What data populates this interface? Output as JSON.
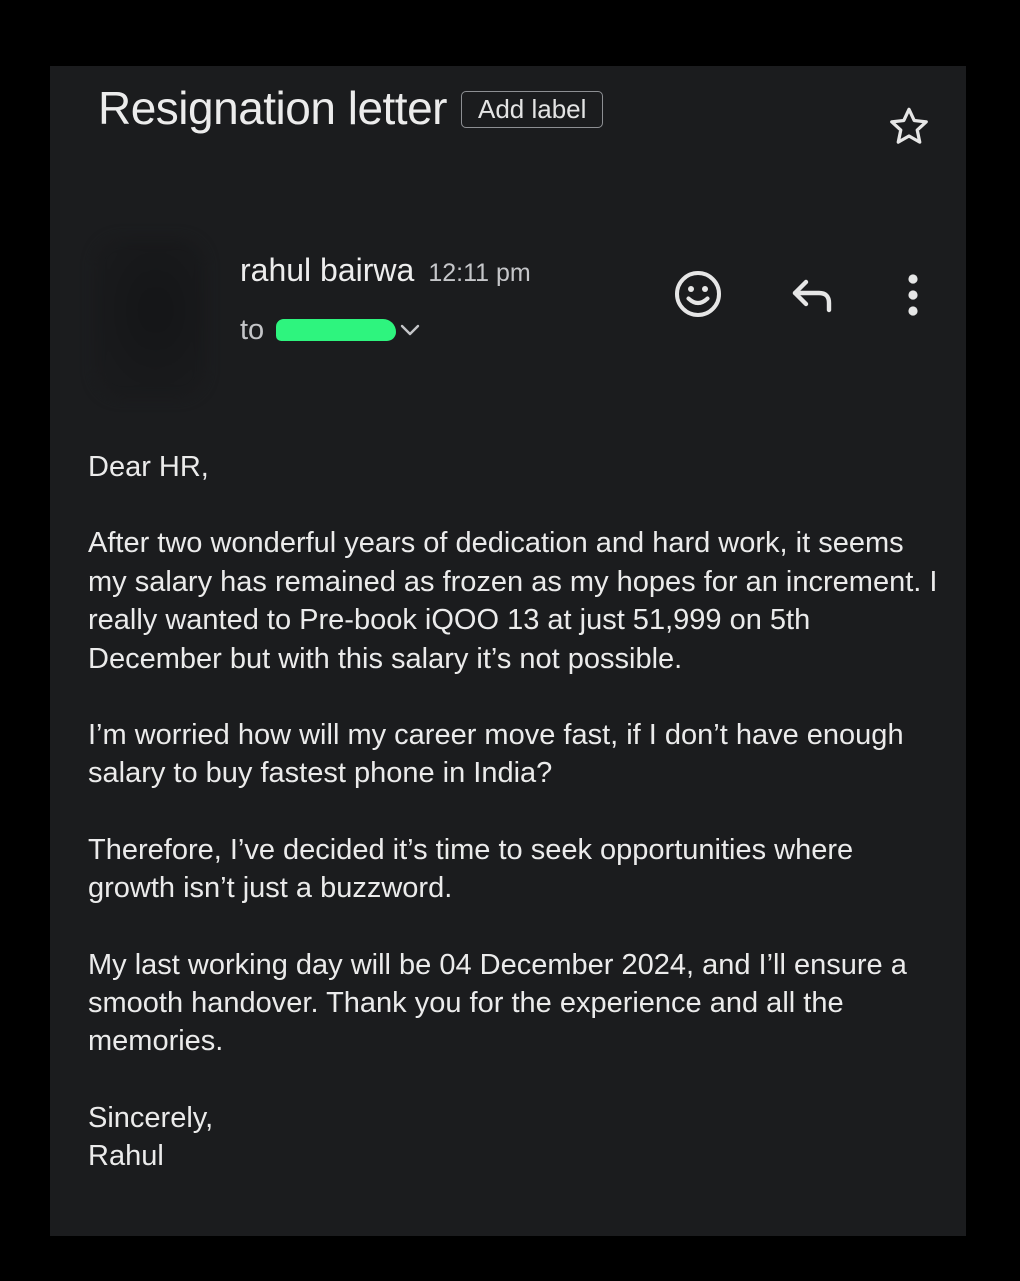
{
  "email": {
    "subject": "Resignation letter",
    "add_label": "Add label",
    "sender": "rahul bairwa",
    "time": "12:11 pm",
    "to_label": "to"
  },
  "body": {
    "greeting": "Dear HR,",
    "paragraph1": "After two wonderful years of dedication and hard work, it seems my salary has remained as frozen as my hopes for an increment. I really wanted to Pre-book iQOO 13 at just 51,999 on 5th December but with this salary it’s not possible.",
    "paragraph2": "I’m worried how will my career move fast, if I don’t have enough salary to buy fastest phone in India?",
    "paragraph3": "Therefore, I’ve decided it’s time to seek opportunities where growth isn’t just a buzzword.",
    "paragraph4": "My last working day will be 04 December 2024, and I’ll ensure a smooth handover. Thank you for the experience and all the memories.",
    "closing": "Sincerely,",
    "signature": "Rahul"
  },
  "icons": {
    "star": "star-icon",
    "emoji": "emoji-reaction-icon",
    "reply": "reply-icon",
    "more": "more-vert-icon",
    "chevron": "chevron-down-icon"
  },
  "colors": {
    "background": "#1b1c1e",
    "redaction": "#2ef47e"
  }
}
